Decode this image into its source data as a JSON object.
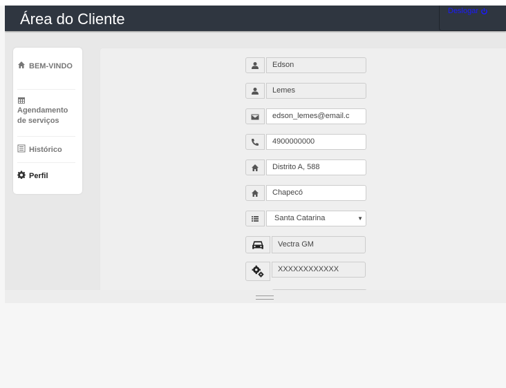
{
  "header": {
    "title": "Área do Cliente",
    "logout_label": "Deslogar"
  },
  "sidebar": {
    "items": [
      {
        "label": "BEM-VINDO",
        "icon": "home-icon"
      },
      {
        "label": "Agendamento de serviços",
        "icon": "calendar-icon"
      },
      {
        "label": "Histórico",
        "icon": "list-icon"
      },
      {
        "label": "Perfil",
        "icon": "gear-icon",
        "active": true
      }
    ]
  },
  "profile_form": {
    "first_name": "Edson",
    "last_name": "Lemes",
    "email": "edson_lemes@email.c",
    "phone": "4900000000",
    "address": "Distrito A, 588",
    "city": "Chapecó",
    "state": "Santa Catarina",
    "vehicle": "Vectra GM",
    "vehicle_code": "XXXXXXXXXXXX"
  },
  "colors": {
    "header_bg": "#2f3640",
    "logout_link": "#1a1aff"
  }
}
